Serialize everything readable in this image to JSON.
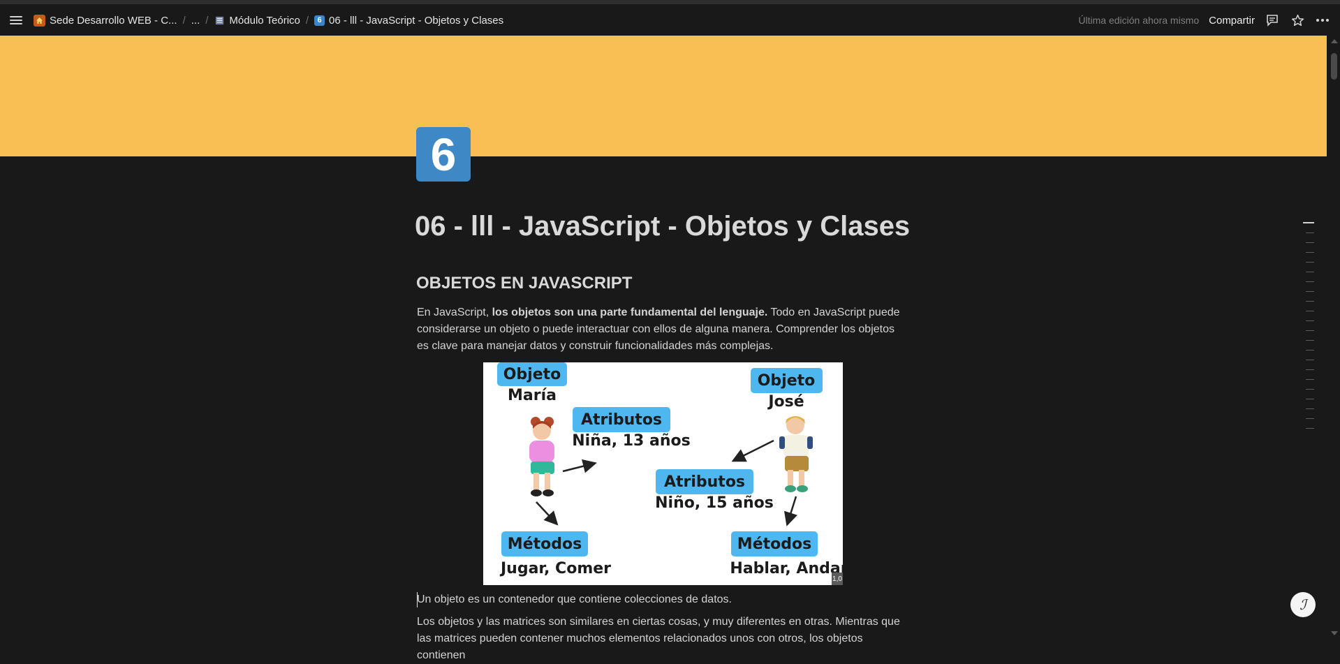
{
  "colors": {
    "background": "#191919",
    "cover": "#f9be54",
    "page_icon": "#3e88c6",
    "label_blue": "#4fb7f0"
  },
  "breadcrumb": {
    "items": [
      {
        "label": "Sede Desarrollo WEB - C...",
        "icon": "home-icon"
      },
      {
        "label": "..."
      },
      {
        "label": "Módulo Teórico",
        "icon": "book-icon"
      },
      {
        "label": "06 - lll - JavaScript - Objetos y Clases",
        "icon": "page-6-icon"
      }
    ]
  },
  "topbar": {
    "last_edit": "Última edición ahora mismo",
    "share_label": "Compartir",
    "icons": [
      "comment-icon",
      "star-icon",
      "more-icon"
    ]
  },
  "page": {
    "icon_text": "6",
    "title": "06 - lll - JavaScript - Objetos y Clases",
    "heading": "OBJETOS EN JAVASCRIPT",
    "intro_before": "En JavaScript, ",
    "intro_bold": "los objetos son una parte fundamental del lenguaje.",
    "intro_after": " Todo en JavaScript puede considerarse un objeto o puede interactuar con ellos de alguna manera. Comprender los objetos es clave para manejar datos y construir funcionalidades más complejas.",
    "para2": "Un objeto es un contenedor que contiene colecciones de datos.",
    "para3": "Los objetos y las matrices son similares en ciertas cosas, y muy diferentes en otras. Mientras que las matrices pueden contener muchos elementos relacionados unos con otros, los objetos contienen"
  },
  "figure": {
    "left": {
      "object_label": "Objeto",
      "object_name": "María",
      "attributes_label": "Atributos",
      "attributes_value": "Niña, 13 años",
      "methods_label": "Métodos",
      "methods_value": "Jugar, Comer"
    },
    "right": {
      "object_label": "Objeto",
      "object_name": "José",
      "attributes_label": "Atributos",
      "attributes_value": "Niño, 15 años",
      "methods_label": "Métodos",
      "methods_value": "Hablar, Andar"
    },
    "zoom_badge": "1,0"
  }
}
